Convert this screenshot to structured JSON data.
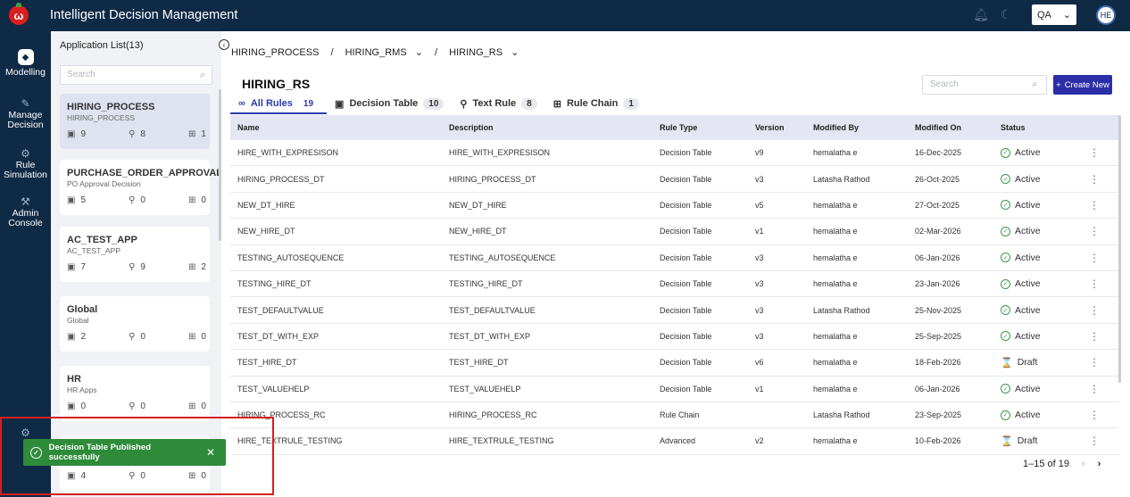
{
  "header": {
    "logo_letter": "ω",
    "title": "Intelligent Decision Management",
    "env_value": "QA",
    "avatar_initials": "HE"
  },
  "nav": [
    {
      "label": "Modelling",
      "icon": "cube-icon"
    },
    {
      "label": "Manage Decision",
      "icon": "edit-document-icon"
    },
    {
      "label": "Rule Simulation",
      "icon": "simulation-icon"
    },
    {
      "label": "Admin Console",
      "icon": "admin-icon"
    }
  ],
  "applist": {
    "title": "Application List(13)",
    "search_placeholder": "Search",
    "apps": [
      {
        "name": "HIRING_PROCESS",
        "sub": "HIRING_PROCESS",
        "dt": "9",
        "tr": "8",
        "rc": "1"
      },
      {
        "name": "PURCHASE_ORDER_APPROVAL",
        "sub": "PO Approval Decision",
        "dt": "5",
        "tr": "0",
        "rc": "0"
      },
      {
        "name": "AC_TEST_APP",
        "sub": "AC_TEST_APP",
        "dt": "7",
        "tr": "9",
        "rc": "2"
      },
      {
        "name": "Global",
        "sub": "Global",
        "dt": "2",
        "tr": "0",
        "rc": "0"
      },
      {
        "name": "HR",
        "sub": "HR Apps",
        "dt": "0",
        "tr": "0",
        "rc": "0"
      },
      {
        "name": "",
        "sub": "",
        "dt": "4",
        "tr": "0",
        "rc": "0"
      }
    ]
  },
  "breadcrumb": {
    "a": "HIRING_PROCESS",
    "b": "HIRING_RMS",
    "c": "HIRING_RS"
  },
  "page_title": "HIRING_RS",
  "tabs": [
    {
      "label": "All Rules",
      "count": "19"
    },
    {
      "label": "Decision Table",
      "count": "10"
    },
    {
      "label": "Text Rule",
      "count": "8"
    },
    {
      "label": "Rule Chain",
      "count": "1"
    }
  ],
  "search_placeholder": "Search",
  "create_label": "Create New",
  "columns": [
    "Name",
    "Description",
    "Rule Type",
    "Version",
    "Modified By",
    "Modified On",
    "Status"
  ],
  "rows": [
    [
      "HIRE_WITH_EXPRESISON",
      "HIRE_WITH_EXPRESISON",
      "Decision Table",
      "v9",
      "hemalatha e",
      "16-Dec-2025",
      "Active"
    ],
    [
      "HIRING_PROCESS_DT",
      "HIRING_PROCESS_DT",
      "Decision Table",
      "v3",
      "Latasha Rathod",
      "26-Oct-2025",
      "Active"
    ],
    [
      "NEW_DT_HIRE",
      "NEW_DT_HIRE",
      "Decision Table",
      "v5",
      "hemalatha e",
      "27-Oct-2025",
      "Active"
    ],
    [
      "NEW_HIRE_DT",
      "NEW_HIRE_DT",
      "Decision Table",
      "v1",
      "hemalatha e",
      "02-Mar-2026",
      "Active"
    ],
    [
      "TESTING_AUTOSEQUENCE",
      "TESTING_AUTOSEQUENCE",
      "Decision Table",
      "v3",
      "hemalatha e",
      "06-Jan-2026",
      "Active"
    ],
    [
      "TESTING_HIRE_DT",
      "TESTING_HIRE_DT",
      "Decision Table",
      "v3",
      "hemalatha e",
      "23-Jan-2026",
      "Active"
    ],
    [
      "TEST_DEFAULTVALUE",
      "TEST_DEFAULTVALUE",
      "Decision Table",
      "v3",
      "Latasha Rathod",
      "25-Nov-2025",
      "Active"
    ],
    [
      "TEST_DT_WITH_EXP",
      "TEST_DT_WITH_EXP",
      "Decision Table",
      "v3",
      "hemalatha e",
      "25-Sep-2025",
      "Active"
    ],
    [
      "TEST_HIRE_DT",
      "TEST_HIRE_DT",
      "Decision Table",
      "v6",
      "hemalatha e",
      "18-Feb-2026",
      "Draft"
    ],
    [
      "TEST_VALUEHELP",
      "TEST_VALUEHELP",
      "Decision Table",
      "v1",
      "hemalatha e",
      "06-Jan-2026",
      "Active"
    ],
    [
      "HIRING_PROCESS_RC",
      "HIRING_PROCESS_RC",
      "Rule Chain",
      "",
      "Latasha Rathod",
      "23-Sep-2025",
      "Active"
    ],
    [
      "HIRE_TEXTRULE_TESTING",
      "HIRE_TEXTRULE_TESTING",
      "Advanced",
      "v2",
      "hemalatha e",
      "10-Feb-2026",
      "Draft"
    ]
  ],
  "pager": "1–15 of 19",
  "toast": "Decision Table Published successfully"
}
